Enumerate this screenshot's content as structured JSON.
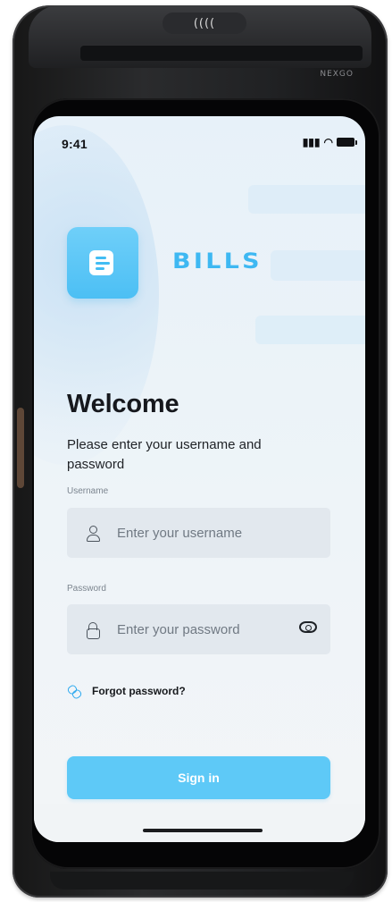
{
  "device": {
    "nfc_mark": "((((",
    "brand_mark": "NEXGO"
  },
  "status_bar": {
    "time": "9:41",
    "signal": "▮▮▮",
    "wifi": "◠"
  },
  "logo": {
    "brand_name": "BILLS",
    "accent_color": "#4cbff4"
  },
  "welcome": {
    "title": "Welcome",
    "subtitle": "Please enter your username and password"
  },
  "form": {
    "username_label": "Username",
    "username_placeholder": "Enter your username",
    "password_label": "Password",
    "password_placeholder": "Enter your password",
    "forgot_password": "Forgot password?",
    "sign_in_label": "Sign in"
  },
  "icons": {
    "username": "user-icon",
    "password": "lock-icon",
    "toggle_password": "eye-icon",
    "forgot_password": "chain-icon"
  }
}
